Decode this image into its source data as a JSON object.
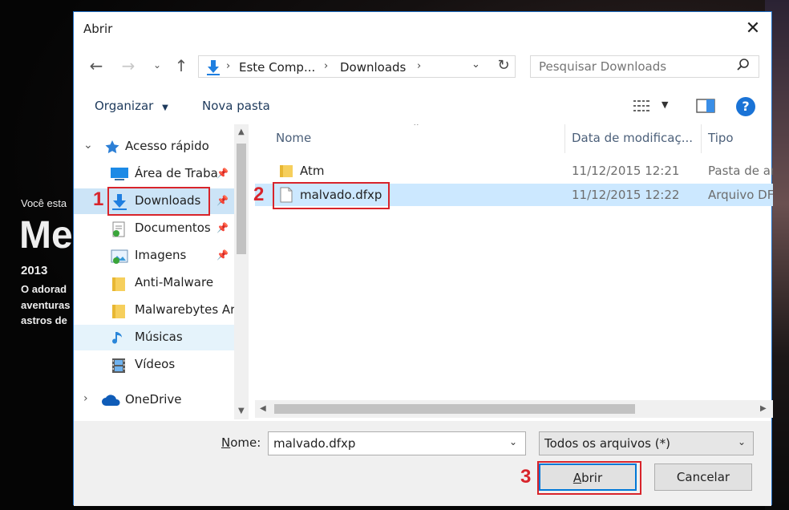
{
  "background": {
    "subtitle": "Você esta",
    "title": "Me",
    "year": "2013",
    "desc_lines": [
      "O adorad",
      "aventuras",
      "astros de"
    ]
  },
  "dialog": {
    "title": "Abrir",
    "close": "✕"
  },
  "address": {
    "crumbs": [
      "Este Comp...",
      "Downloads"
    ],
    "search_placeholder": "Pesquisar Downloads"
  },
  "toolbar": {
    "organize": "Organizar",
    "new_folder": "Nova pasta",
    "help": "?"
  },
  "navpane": {
    "quick_access": "Acesso rápido",
    "items": [
      {
        "label": "Área de Traba",
        "icon": "desktop-icon",
        "pinned": true
      },
      {
        "label": "Downloads",
        "icon": "downloads-icon",
        "pinned": true
      },
      {
        "label": "Documentos",
        "icon": "documents-icon",
        "pinned": true
      },
      {
        "label": "Imagens",
        "icon": "pictures-icon",
        "pinned": true
      },
      {
        "label": "Anti-Malware",
        "icon": "folder-icon",
        "pinned": false
      },
      {
        "label": "Malwarebytes Ar",
        "icon": "folder-icon",
        "pinned": false
      },
      {
        "label": "Músicas",
        "icon": "music-icon",
        "pinned": false
      },
      {
        "label": "Vídeos",
        "icon": "videos-icon",
        "pinned": false
      }
    ],
    "onedrive": "OneDrive"
  },
  "filelist": {
    "columns": [
      "Nome",
      "Data de modificaç...",
      "Tipo"
    ],
    "rows": [
      {
        "name": "Atm",
        "date": "11/12/2015 12:21",
        "type": "Pasta de ar",
        "icon": "folder-icon"
      },
      {
        "name": "malvado.dfxp",
        "date": "11/12/2015 12:22",
        "type": "Arquivo DF",
        "icon": "file-icon"
      }
    ]
  },
  "footer": {
    "name_label": "Nome:",
    "name_label_underlined": "N",
    "name_label_rest": "ome:",
    "filename": "malvado.dfxp",
    "filter": "Todos os arquivos (*)",
    "open_label": "Abrir",
    "open_label_underlined": "A",
    "open_label_rest": "brir",
    "cancel_label": "Cancelar"
  },
  "annotations": [
    "1",
    "2",
    "3"
  ],
  "colors": {
    "accent": "#0078d7",
    "annotation": "#d8242b",
    "selection": "#cce8ff"
  }
}
